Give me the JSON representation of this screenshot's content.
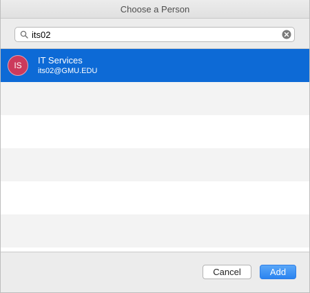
{
  "window": {
    "title": "Choose a Person"
  },
  "search": {
    "value": "its02"
  },
  "results": [
    {
      "initials": "IS",
      "name": "IT Services",
      "email": "its02@GMU.EDU",
      "selected": true
    }
  ],
  "buttons": {
    "cancel_label": "Cancel",
    "add_label": "Add"
  },
  "icons": {
    "search": "magnifier-icon",
    "clear": "clear-search-icon"
  },
  "colors": {
    "selection": "#0d6ad6",
    "avatar": "#cc3a5c",
    "primary_button": "#2a83f0"
  }
}
